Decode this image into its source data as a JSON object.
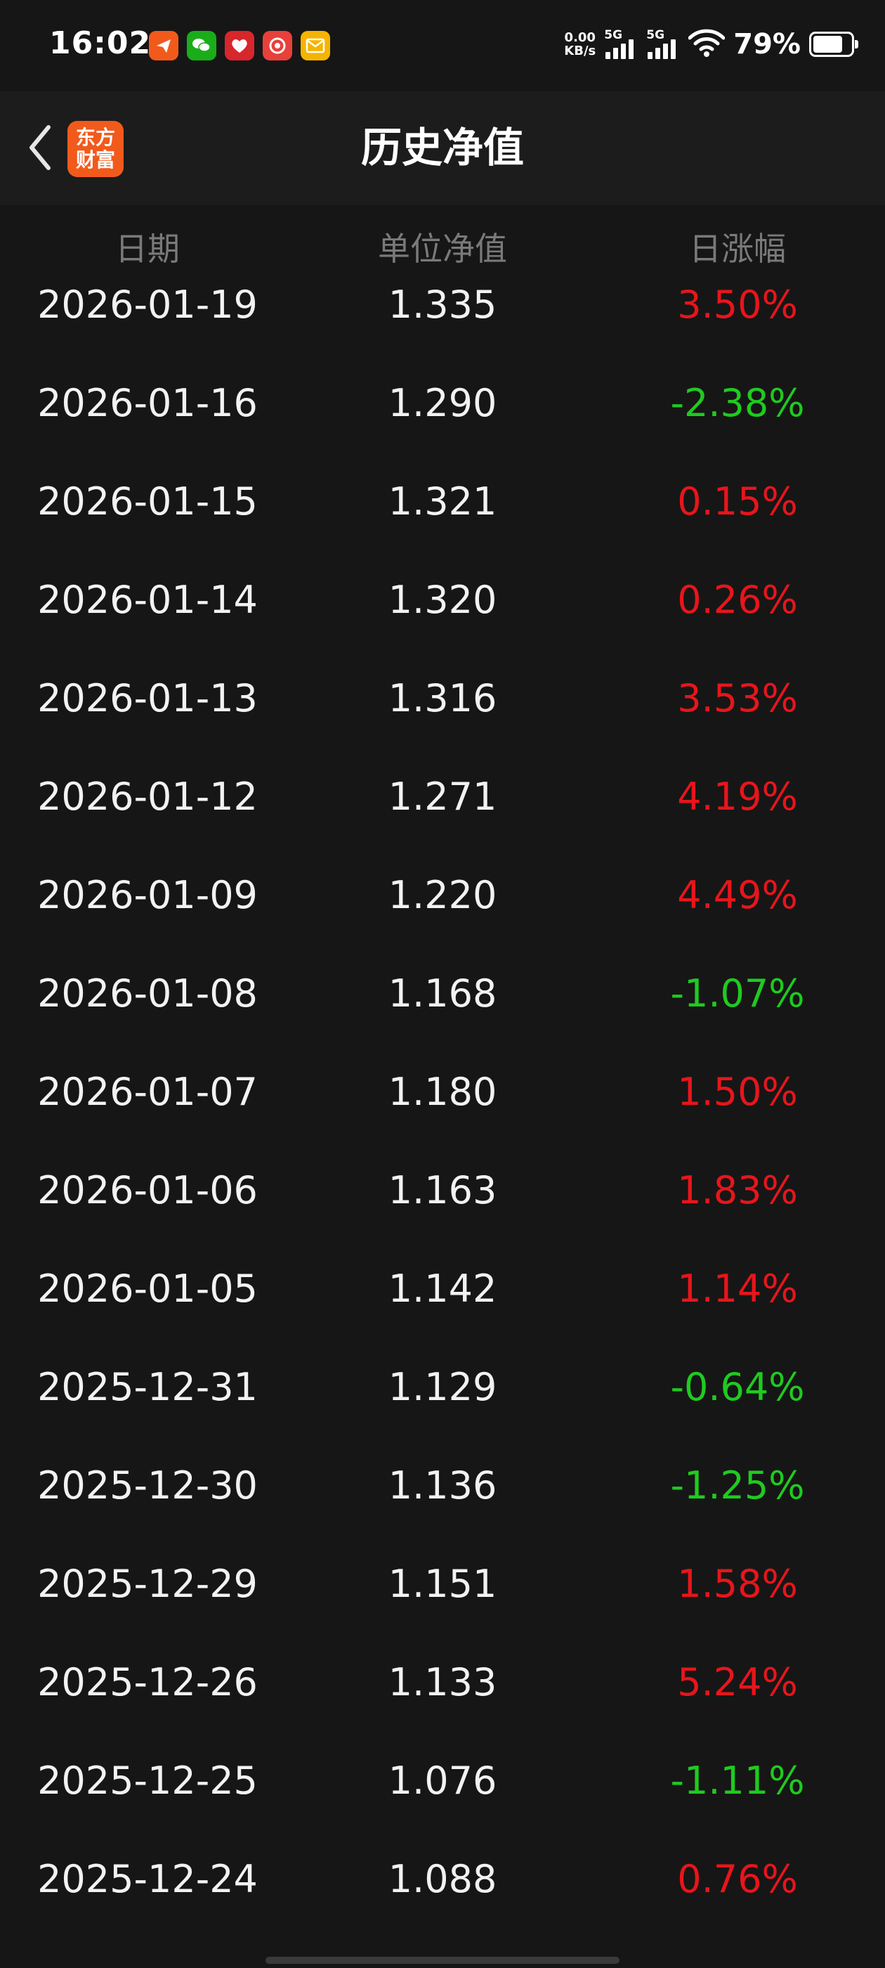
{
  "status_bar": {
    "time": "16:02",
    "net_speed_value": "0.00",
    "net_speed_unit": "KB/s",
    "signal_1_label": "5G",
    "signal_2_label": "5G",
    "battery_percent": "79%",
    "battery_level": 0.79,
    "notification_icons": [
      {
        "name": "paper-plane-app-icon",
        "color": "#f25a1c"
      },
      {
        "name": "wechat-app-icon",
        "color": "#1aad19"
      },
      {
        "name": "heart-app-icon",
        "color": "#d7262c"
      },
      {
        "name": "red-circle-app-icon",
        "color": "#e8403a"
      },
      {
        "name": "mail-app-icon",
        "color": "#f5b400"
      }
    ]
  },
  "header": {
    "title": "历史净值",
    "logo_line1": "东方",
    "logo_line2": "财富"
  },
  "table": {
    "columns": {
      "date": "日期",
      "nav": "单位净值",
      "change": "日涨幅"
    },
    "rows": [
      {
        "date": "2026-01-19",
        "nav": "1.335",
        "change": "3.50%",
        "dir": "up"
      },
      {
        "date": "2026-01-16",
        "nav": "1.290",
        "change": "-2.38%",
        "dir": "down"
      },
      {
        "date": "2026-01-15",
        "nav": "1.321",
        "change": "0.15%",
        "dir": "up"
      },
      {
        "date": "2026-01-14",
        "nav": "1.320",
        "change": "0.26%",
        "dir": "up"
      },
      {
        "date": "2026-01-13",
        "nav": "1.316",
        "change": "3.53%",
        "dir": "up"
      },
      {
        "date": "2026-01-12",
        "nav": "1.271",
        "change": "4.19%",
        "dir": "up"
      },
      {
        "date": "2026-01-09",
        "nav": "1.220",
        "change": "4.49%",
        "dir": "up"
      },
      {
        "date": "2026-01-08",
        "nav": "1.168",
        "change": "-1.07%",
        "dir": "down"
      },
      {
        "date": "2026-01-07",
        "nav": "1.180",
        "change": "1.50%",
        "dir": "up"
      },
      {
        "date": "2026-01-06",
        "nav": "1.163",
        "change": "1.83%",
        "dir": "up"
      },
      {
        "date": "2026-01-05",
        "nav": "1.142",
        "change": "1.14%",
        "dir": "up"
      },
      {
        "date": "2025-12-31",
        "nav": "1.129",
        "change": "-0.64%",
        "dir": "down"
      },
      {
        "date": "2025-12-30",
        "nav": "1.136",
        "change": "-1.25%",
        "dir": "down"
      },
      {
        "date": "2025-12-29",
        "nav": "1.151",
        "change": "1.58%",
        "dir": "up"
      },
      {
        "date": "2025-12-26",
        "nav": "1.133",
        "change": "5.24%",
        "dir": "up"
      },
      {
        "date": "2025-12-25",
        "nav": "1.076",
        "change": "-1.11%",
        "dir": "down"
      },
      {
        "date": "2025-12-24",
        "nav": "1.088",
        "change": "0.76%",
        "dir": "up"
      }
    ]
  },
  "colors": {
    "background": "#161616",
    "header_background": "#1c1c1c",
    "up": "#e8151b",
    "down": "#1fcb1f",
    "column_header": "#7a7a7a",
    "logo": "#f25a1c"
  }
}
